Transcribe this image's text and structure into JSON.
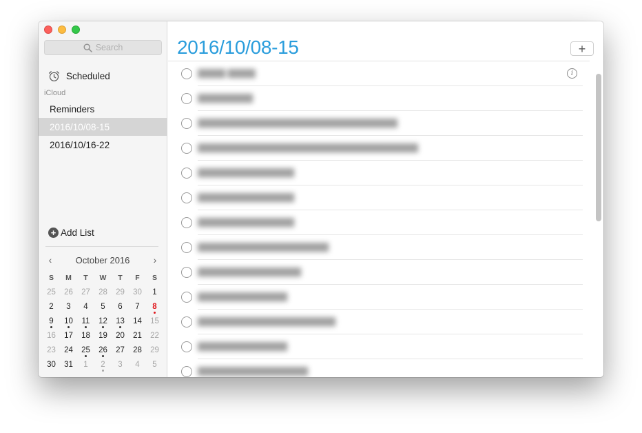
{
  "sidebar": {
    "search_placeholder": "Search",
    "scheduled_label": "Scheduled",
    "section_label": "iCloud",
    "lists": [
      {
        "label": "Reminders",
        "selected": false
      },
      {
        "label": "2016/10/08-15",
        "selected": true
      },
      {
        "label": "2016/10/16-22",
        "selected": false
      }
    ],
    "add_list_label": "Add List"
  },
  "calendar": {
    "month_label": "October 2016",
    "prev_glyph": "‹",
    "next_glyph": "›",
    "weekdays": [
      "S",
      "M",
      "T",
      "W",
      "T",
      "F",
      "S"
    ],
    "weeks": [
      [
        {
          "d": "25",
          "dim": true
        },
        {
          "d": "26",
          "dim": true
        },
        {
          "d": "27",
          "dim": true
        },
        {
          "d": "28",
          "dim": true
        },
        {
          "d": "29",
          "dim": true
        },
        {
          "d": "30",
          "dim": true
        },
        {
          "d": "1"
        }
      ],
      [
        {
          "d": "2"
        },
        {
          "d": "3"
        },
        {
          "d": "4"
        },
        {
          "d": "5"
        },
        {
          "d": "6"
        },
        {
          "d": "7"
        },
        {
          "d": "8",
          "today": true,
          "dot": true
        }
      ],
      [
        {
          "d": "9",
          "dot": true
        },
        {
          "d": "10",
          "dot": true
        },
        {
          "d": "11",
          "dot": true
        },
        {
          "d": "12",
          "dot": true
        },
        {
          "d": "13",
          "dot": true
        },
        {
          "d": "14"
        },
        {
          "d": "15",
          "dim": true
        }
      ],
      [
        {
          "d": "16",
          "dim": true
        },
        {
          "d": "17"
        },
        {
          "d": "18"
        },
        {
          "d": "19"
        },
        {
          "d": "20"
        },
        {
          "d": "21"
        },
        {
          "d": "22",
          "dim": true
        }
      ],
      [
        {
          "d": "23",
          "dim": true
        },
        {
          "d": "24"
        },
        {
          "d": "25",
          "dot": true
        },
        {
          "d": "26",
          "dot": true
        },
        {
          "d": "27"
        },
        {
          "d": "28"
        },
        {
          "d": "29",
          "dim": true
        }
      ],
      [
        {
          "d": "30"
        },
        {
          "d": "31"
        },
        {
          "d": "1",
          "dim": true
        },
        {
          "d": "2",
          "dim": true,
          "dot": true
        },
        {
          "d": "3",
          "dim": true
        },
        {
          "d": "4",
          "dim": true
        },
        {
          "d": "5",
          "dim": true
        }
      ]
    ]
  },
  "main": {
    "title": "2016/10/08-15",
    "add_glyph": "+",
    "info_glyph": "i",
    "tasks": [
      {
        "text": "▇▇▇▇ ▇▇▇▇",
        "info": true
      },
      {
        "text": "▇▇▇▇▇▇▇▇"
      },
      {
        "text": "▇▇▇▇▇▇▇▇▇▇▇▇▇▇▇▇▇▇▇▇▇▇▇▇▇▇▇▇▇"
      },
      {
        "text": "▇▇▇▇▇▇▇▇▇▇▇▇▇▇▇▇▇▇▇▇▇▇▇▇▇▇▇▇▇▇▇▇"
      },
      {
        "text": "▇▇▇▇▇▇▇▇▇▇▇▇▇▇"
      },
      {
        "text": "▇▇▇▇▇▇▇▇▇▇▇▇▇▇"
      },
      {
        "text": "▇▇▇▇▇▇▇▇▇▇▇▇▇▇"
      },
      {
        "text": "▇▇▇▇▇▇▇▇▇▇▇▇▇▇▇▇▇▇▇"
      },
      {
        "text": "▇▇▇▇▇▇▇▇▇▇▇▇▇▇▇"
      },
      {
        "text": "▇▇▇▇▇▇▇▇▇▇▇▇▇"
      },
      {
        "text": "▇▇▇▇▇▇▇▇▇▇▇▇▇▇▇▇▇▇▇▇"
      },
      {
        "text": "▇▇▇▇▇▇▇▇▇▇▇▇▇"
      },
      {
        "text": "▇▇▇▇▇▇▇▇▇▇▇▇▇▇▇▇"
      }
    ]
  },
  "colors": {
    "accent": "#2a9ddc",
    "today": "#e0161c",
    "selected_row": "#d5d5d5"
  }
}
